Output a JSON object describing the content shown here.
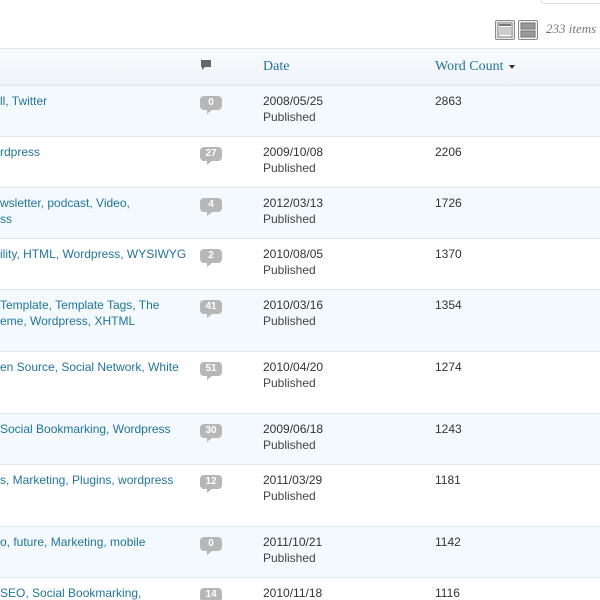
{
  "toolbar": {
    "items_count": "233 items",
    "view_modes": [
      {
        "name": "list-view",
        "icon": "list-view-icon"
      },
      {
        "name": "excerpt-view",
        "icon": "excerpt-view-icon"
      }
    ]
  },
  "columns": {
    "comments_icon": "comment-bubble-icon",
    "date": "Date",
    "word_count": "Word Count",
    "word_count_sort": "sort-descending-arrow"
  },
  "rows": [
    {
      "tags": [
        "ll, Twitter"
      ],
      "comments": "0",
      "date": "2008/05/25",
      "status": "Published",
      "words": "2863"
    },
    {
      "tags": [
        "rdpress"
      ],
      "comments": "27",
      "date": "2009/10/08",
      "status": "Published",
      "words": "2206"
    },
    {
      "tags": [
        "wsletter, podcast, Video,",
        "ss"
      ],
      "comments": "4",
      "date": "2012/03/13",
      "status": "Published",
      "words": "1726"
    },
    {
      "tags": [
        "ility, HTML, Wordpress, WYSIWYG"
      ],
      "comments": "2",
      "date": "2010/08/05",
      "status": "Published",
      "words": "1370"
    },
    {
      "tags": [
        " Template, Template Tags, The",
        "eme, Wordpress, XHTML"
      ],
      "comments": "41",
      "date": "2010/03/16",
      "status": "Published",
      "words": "1354"
    },
    {
      "tags": [
        "en Source, Social Network, White"
      ],
      "comments": "51",
      "date": "2010/04/20",
      "status": "Published",
      "words": "1274"
    },
    {
      "tags": [
        " Social Bookmarking, Wordpress"
      ],
      "comments": "30",
      "date": "2009/06/18",
      "status": "Published",
      "words": "1243"
    },
    {
      "tags": [
        "s, Marketing, Plugins, wordpress"
      ],
      "comments": "12",
      "date": "2011/03/29",
      "status": "Published",
      "words": "1181"
    },
    {
      "tags": [
        "o, future, Marketing, mobile"
      ],
      "comments": "0",
      "date": "2011/10/21",
      "status": "Published",
      "words": "1142"
    },
    {
      "tags": [
        "SEO, Social Bookmarking,"
      ],
      "comments": "14",
      "date": "2010/11/18",
      "status": "",
      "words": "1116"
    }
  ],
  "colors": {
    "link": "#21759b",
    "alt_row": "#f4f9fd",
    "bubble": "#b7b7b7",
    "border": "#e3e8ec"
  }
}
